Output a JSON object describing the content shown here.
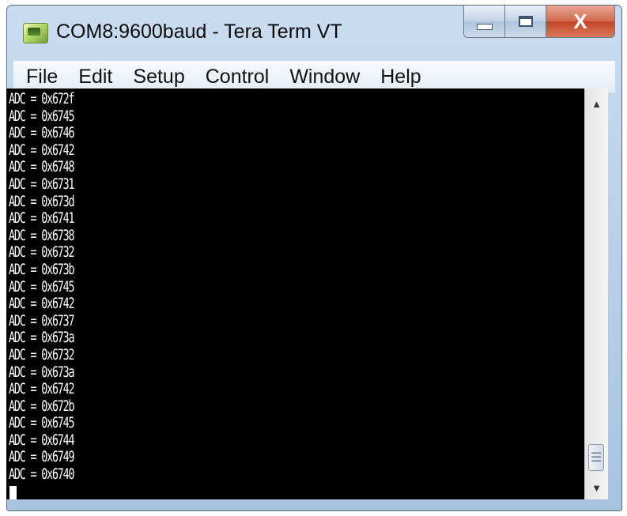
{
  "window": {
    "title": "COM8:9600baud - Tera Term VT",
    "icon": "tera-term-app-icon",
    "controls": {
      "minimize_icon": "minimize-icon",
      "maximize_icon": "maximize-icon",
      "close_label": "X"
    }
  },
  "menubar": {
    "items": [
      {
        "label": "File"
      },
      {
        "label": "Edit"
      },
      {
        "label": "Setup"
      },
      {
        "label": "Control"
      },
      {
        "label": "Window"
      },
      {
        "label": "Help"
      }
    ]
  },
  "terminal": {
    "lines": [
      "ADC = 0x672f",
      "ADC = 0x6745",
      "ADC = 0x6746",
      "ADC = 0x6742",
      "ADC = 0x6748",
      "ADC = 0x6731",
      "ADC = 0x673d",
      "ADC = 0x6741",
      "ADC = 0x6738",
      "ADC = 0x6732",
      "ADC = 0x673b",
      "ADC = 0x6745",
      "ADC = 0x6742",
      "ADC = 0x6737",
      "ADC = 0x673a",
      "ADC = 0x6732",
      "ADC = 0x673a",
      "ADC = 0x6742",
      "ADC = 0x672b",
      "ADC = 0x6745",
      "ADC = 0x6744",
      "ADC = 0x6749",
      "ADC = 0x6740"
    ],
    "background": "#000000",
    "foreground": "#ffffff"
  },
  "scrollbar": {
    "up_arrow": "▲",
    "down_arrow": "▼",
    "thumb_grip": "☰"
  }
}
